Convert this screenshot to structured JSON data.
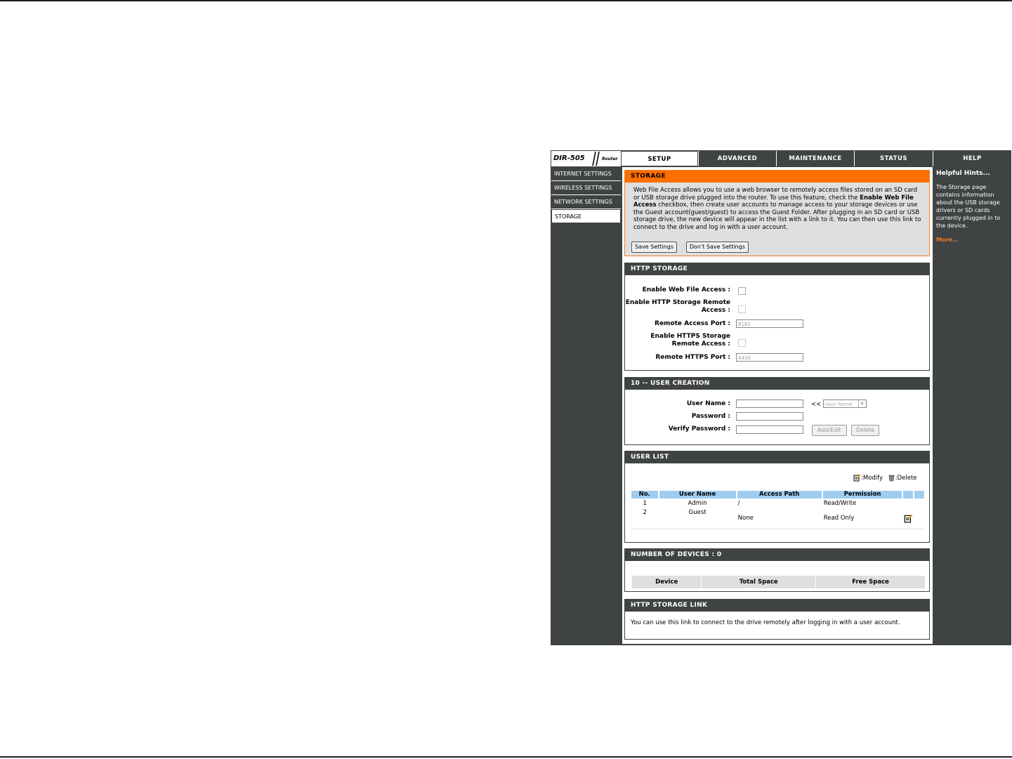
{
  "header": {
    "model": "DIR-505",
    "product_type": "Router",
    "tabs": [
      {
        "label": "SETUP",
        "active": true
      },
      {
        "label": "ADVANCED",
        "active": false
      },
      {
        "label": "MAINTENANCE",
        "active": false
      },
      {
        "label": "STATUS",
        "active": false
      },
      {
        "label": "HELP",
        "active": false
      }
    ]
  },
  "sidebar": {
    "items": [
      {
        "label": "INTERNET SETTINGS",
        "active": false
      },
      {
        "label": "WIRELESS SETTINGS",
        "active": false
      },
      {
        "label": "NETWORK SETTINGS",
        "active": false
      },
      {
        "label": "STORAGE",
        "active": true
      }
    ]
  },
  "storage": {
    "title": "STORAGE",
    "desc_1": "Web File Access allows you to use a web browser to remotely access files stored on an SD card or USB storage drive plugged into the router. To use this feature, check the ",
    "desc_bold": "Enable Web File Access",
    "desc_2": " checkbox, then create user accounts to manage access to your storage devices or use the Guest account(guest/guest) to access the Guest Folder. After plugging in an SD card or USB storage drive, the new device will appear in the list with a link to it. You can then use this link to connect to the drive and log in with a user account.",
    "save_label": "Save Settings",
    "dont_save_label": "Don't Save Settings"
  },
  "http_storage": {
    "title": "HTTP STORAGE",
    "enable_web_label": "Enable Web File Access :",
    "enable_http_remote_label": "Enable HTTP Storage Remote Access :",
    "remote_port_label": "Remote Access Port :",
    "remote_port_value": "8181",
    "enable_https_remote_label": "Enable HTTPS Storage Remote Access :",
    "https_port_label": "Remote HTTPS Port :",
    "https_port_value": "4433"
  },
  "user_creation": {
    "title": "10 -- USER CREATION",
    "username_label": "User Name :",
    "password_label": "Password :",
    "verify_label": "Verify Password :",
    "arrow": "<<",
    "select_value": "User Name",
    "add_edit_label": "Add/Edit",
    "delete_label": "Delete"
  },
  "user_list": {
    "title": "USER LIST",
    "modify_legend": ":Modify",
    "delete_legend": ":Delete",
    "columns": [
      "No.",
      "User Name",
      "Access Path",
      "Permission"
    ],
    "rows": [
      {
        "no": "1",
        "name": "Admin",
        "path": "/",
        "permission": "Read/Write"
      },
      {
        "no": "2",
        "name": "Guest",
        "path": "None",
        "permission": "Read Only"
      }
    ]
  },
  "devices": {
    "title": "NUMBER OF DEVICES : 0",
    "columns": [
      "Device",
      "Total Space",
      "Free Space"
    ]
  },
  "storage_link": {
    "title": "HTTP STORAGE LINK",
    "text": "You can use this link to connect to the drive remotely after logging in with a user account."
  },
  "help": {
    "title": "Helpful Hints...",
    "body": "The Storage page contains information about the USB storage drivers or SD cards currently plugged in to the device.",
    "more": "More..."
  },
  "colors": {
    "dark": "#404343",
    "accent_orange": "#ff6f00",
    "table_header_blue": "#9fcdf0"
  }
}
